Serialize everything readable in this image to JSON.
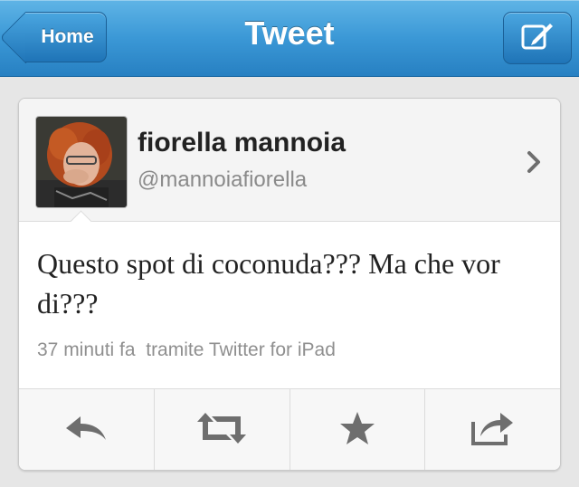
{
  "navbar": {
    "back_label": "Home",
    "title": "Tweet",
    "back_icon": "chevron-left-icon",
    "compose_icon": "compose-icon"
  },
  "tweet": {
    "user_name": "fiorella mannoia",
    "user_handle": "@mannoiafiorella",
    "text": "Questo spot di coconuda??? Ma che vor di???",
    "time": "37 minuti fa",
    "via": "tramite Twitter for iPad"
  },
  "actions": [
    {
      "icon": "reply-icon"
    },
    {
      "icon": "retweet-icon"
    },
    {
      "icon": "favorite-star-icon"
    },
    {
      "icon": "share-icon"
    }
  ],
  "colors": {
    "nav_blue": "#3b98d6",
    "background": "#e6e6e6",
    "text": "#222222",
    "muted": "#8f8f8f",
    "icon": "#6e6e6e"
  }
}
